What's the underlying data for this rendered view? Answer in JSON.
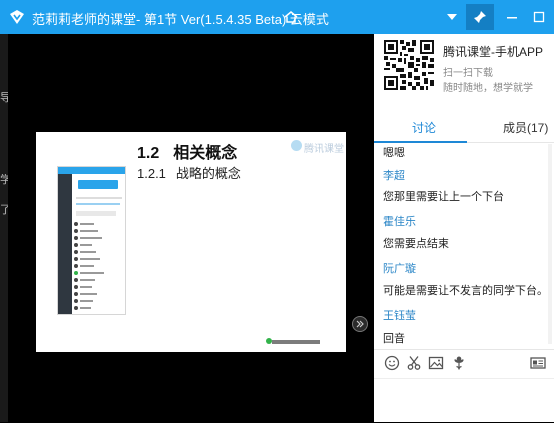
{
  "window": {
    "title": "范莉莉老师的课堂- 第1节 Ver(1.5.4.35 Beta)  云模式",
    "icons": [
      "app-logo-icon",
      "home-icon",
      "chevron-down-icon",
      "pin-icon",
      "minimize-icon",
      "maximize-icon"
    ],
    "accent_color": "#1ea0ee"
  },
  "left_strip": {
    "fragments": [
      "导",
      "学",
      "了"
    ]
  },
  "slide": {
    "section_number": "1.2",
    "section_title": "相关概念",
    "subsection_number": "1.2.1",
    "subsection_title": "战略的概念",
    "watermark": "腾讯课堂"
  },
  "promo": {
    "app_name": "腾讯课堂-手机APP",
    "scan_hint": "扫一扫下载",
    "slogan": "随时随地，想学就学"
  },
  "tabs": {
    "discussion": "讨论",
    "members": "成员(17)",
    "active": "discussion"
  },
  "chat": {
    "messages": [
      {
        "text": "嗯嗯"
      },
      {
        "name": "李超",
        "text": "您那里需要让上一个下台"
      },
      {
        "name": "霍佳乐",
        "text": "您需要点结束"
      },
      {
        "name": "阮广璇",
        "text": "可能是需要让不发言的同学下台。"
      },
      {
        "name": "王钰莹",
        "text": "回音"
      }
    ]
  },
  "toolbar": {
    "icons": [
      "emoji-icon",
      "scissors-icon",
      "image-icon",
      "flower-icon",
      "card-icon"
    ]
  }
}
